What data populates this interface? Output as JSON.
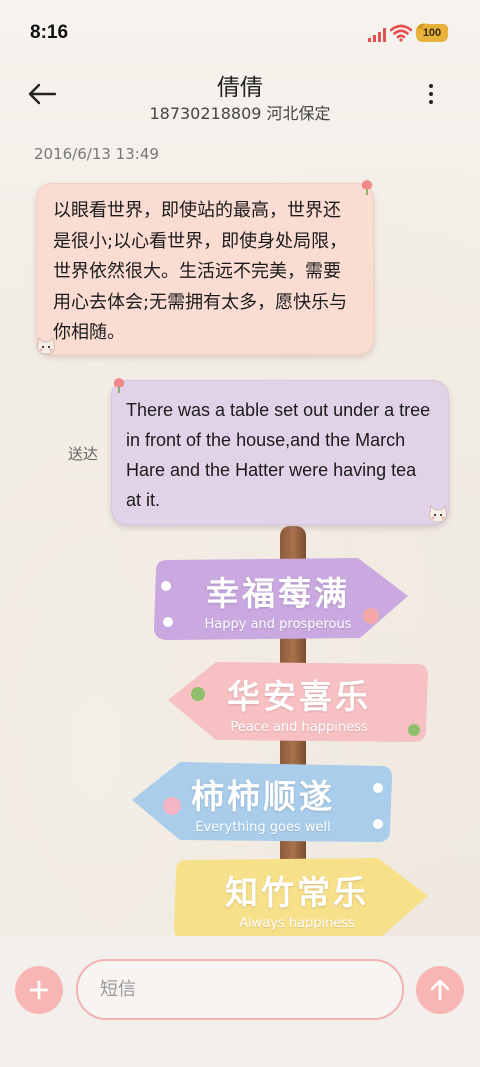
{
  "status_bar": {
    "time": "8:16",
    "battery_level": "100",
    "signal_color": "#e65050",
    "battery_color": "#e8b13a"
  },
  "header": {
    "contact_name": "倩倩",
    "contact_detail": "18730218809 河北保定"
  },
  "conversation": {
    "timestamp": "2016/6/13 13:49",
    "incoming_message": "以眼看世界，即使站的最高，世界还是很小;以心看世界，即使身处局限，世界依然很大。生活远不完美，需要用心去体会;无需拥有太多，愿快乐与你相随。",
    "outgoing_message": "There was a table set out under a tree in front of the house,and the March Hare and the Hatter were having tea at it.",
    "delivery_status": "送达"
  },
  "wallpaper": {
    "signs": [
      {
        "cn": "幸福莓满",
        "en": "Happy and prosperous",
        "color": "#c9a9e0"
      },
      {
        "cn": "华安喜乐",
        "en": "Peace and happiness",
        "color": "#f7c1c4"
      },
      {
        "cn": "柿柿顺遂",
        "en": "Everything goes well",
        "color": "#a9cdeb"
      },
      {
        "cn": "知竹常乐",
        "en": "Always happiness",
        "color": "#f7e08a"
      }
    ]
  },
  "composer": {
    "placeholder": "短信"
  },
  "colors": {
    "accent": "#f7b6b3",
    "incoming_bubble": "#fadcd3",
    "outgoing_bubble": "#e2d2e8"
  }
}
